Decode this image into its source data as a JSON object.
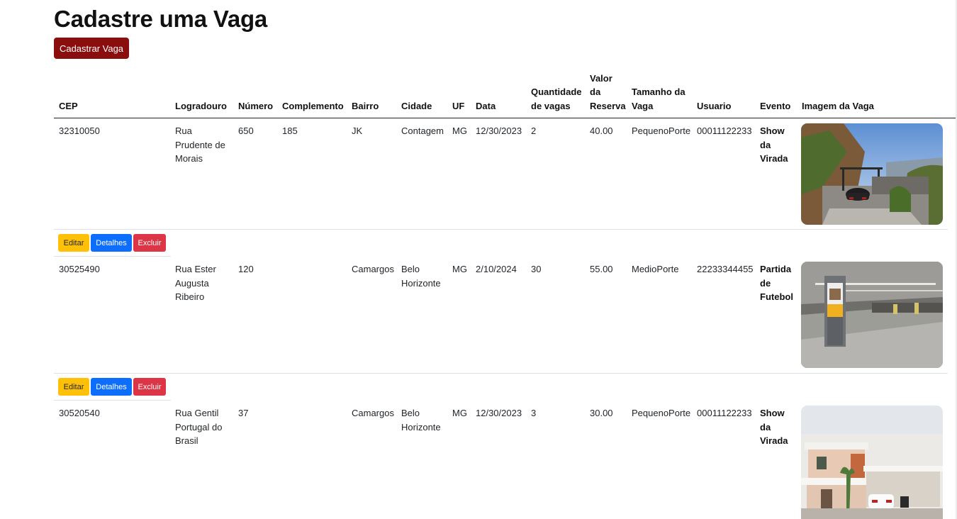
{
  "page": {
    "title": "Cadastre uma Vaga",
    "new_button": "Cadastrar Vaga"
  },
  "table": {
    "headers": {
      "cep": "CEP",
      "logradouro": "Logradouro",
      "numero": "Número",
      "complemento": "Complemento",
      "bairro": "Bairro",
      "cidade": "Cidade",
      "uf": "UF",
      "data": "Data",
      "quantidade": [
        "Quantidade",
        "de vagas"
      ],
      "valor": [
        "Valor",
        "da",
        "Reserva"
      ],
      "tamanho": [
        "Tamanho da",
        "Vaga"
      ],
      "usuario": "Usuario",
      "evento": "Evento",
      "imagem": "Imagem da Vaga"
    },
    "actions": {
      "edit": "Editar",
      "details": "Detalhes",
      "delete": "Excluir"
    },
    "rows": [
      {
        "cep": "32310050",
        "logradouro": [
          "Rua",
          "Prudente de",
          "Morais"
        ],
        "numero": "650",
        "complemento": "185",
        "bairro": "JK",
        "cidade": [
          "Contagem"
        ],
        "uf": "MG",
        "data": "12/30/2023",
        "quantidade": "2",
        "valor": "40.00",
        "tamanho": "PequenoPorte",
        "usuario": "00011122233",
        "evento": [
          "Show",
          "da",
          "Virada"
        ]
      },
      {
        "cep": "30525490",
        "logradouro": [
          "Rua Ester",
          "Augusta",
          "Ribeiro"
        ],
        "numero": "120",
        "complemento": "",
        "bairro": "Camargos",
        "cidade": [
          "Belo",
          "Horizonte"
        ],
        "uf": "MG",
        "data": "2/10/2024",
        "quantidade": "30",
        "valor": "55.00",
        "tamanho": "MedioPorte",
        "usuario": "22233344455",
        "evento": [
          "Partida",
          "de",
          "Futebol"
        ]
      },
      {
        "cep": "30520540",
        "logradouro": [
          "Rua Gentil",
          "Portugal do",
          "Brasil"
        ],
        "numero": "37",
        "complemento": "",
        "bairro": "Camargos",
        "cidade": [
          "Belo",
          "Horizonte"
        ],
        "uf": "MG",
        "data": "12/30/2023",
        "quantidade": "3",
        "valor": "30.00",
        "tamanho": "PequenoPorte",
        "usuario": "00011122233",
        "evento": [
          "Show",
          "da",
          "Virada"
        ]
      }
    ]
  }
}
